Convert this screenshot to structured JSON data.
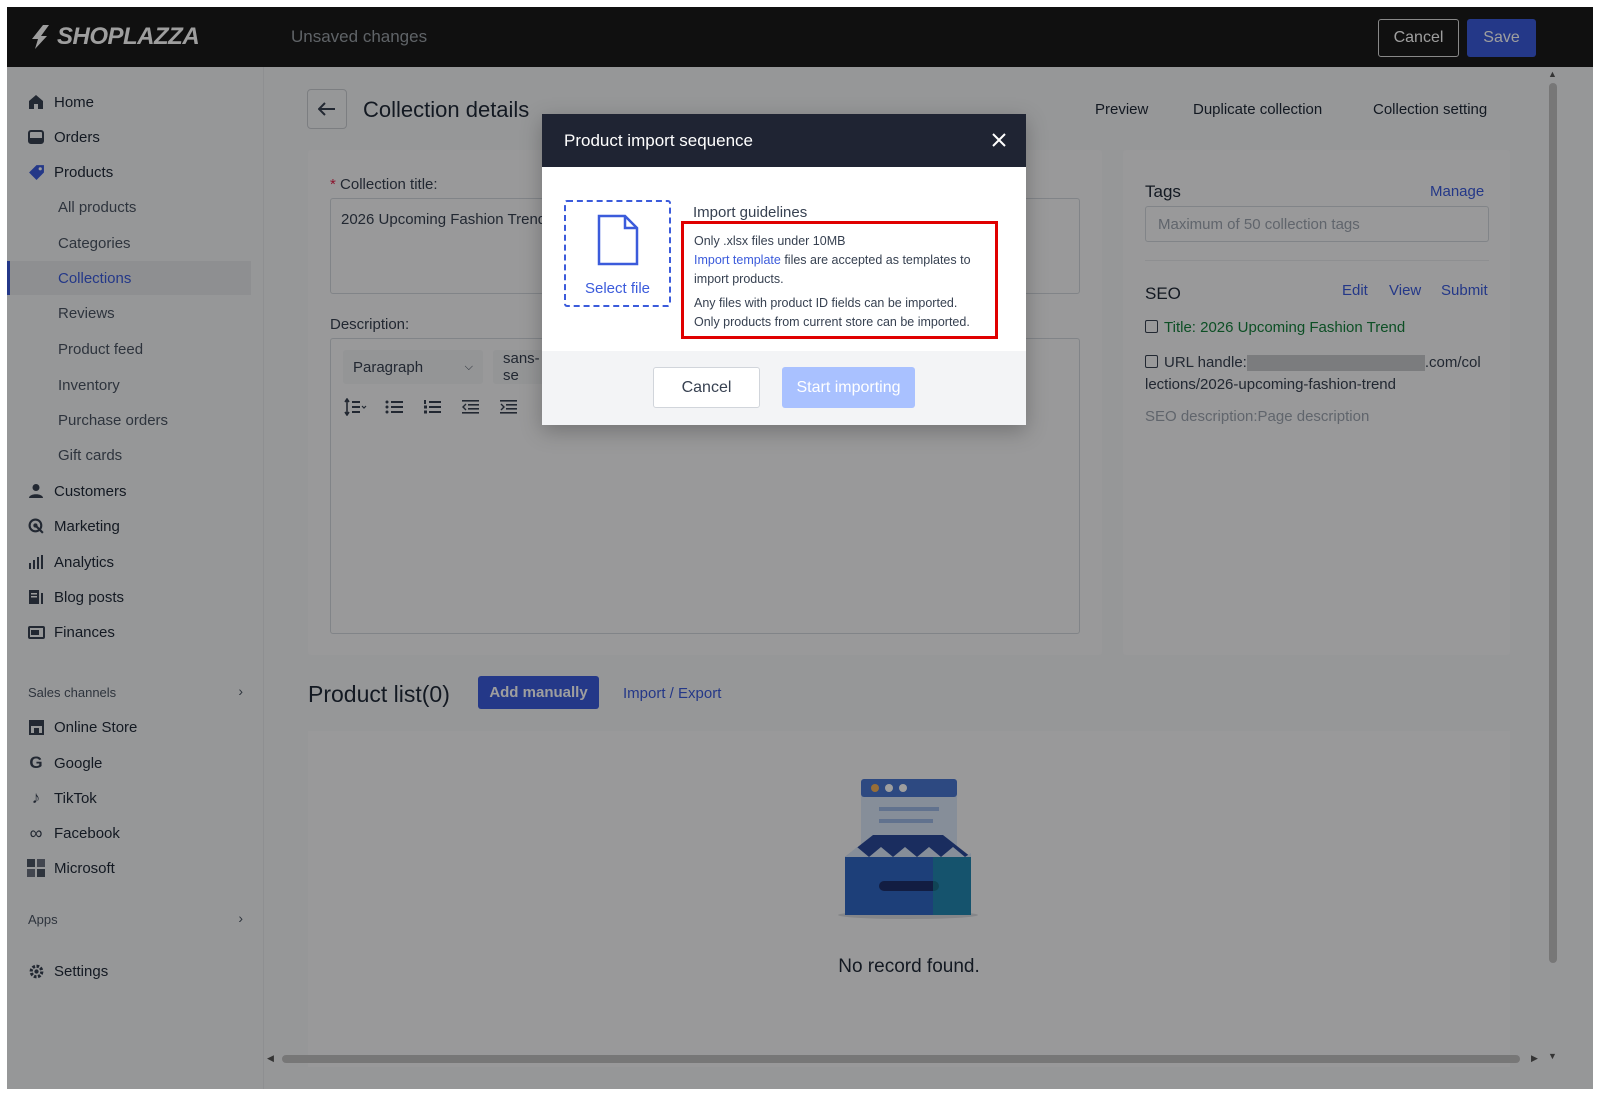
{
  "topbar": {
    "logo_text": "SHOPLAZZA",
    "status_text": "Unsaved changes",
    "cancel_label": "Cancel",
    "save_label": "Save"
  },
  "sidebar": {
    "items": [
      {
        "label": "Home",
        "icon": "home-icon"
      },
      {
        "label": "Orders",
        "icon": "orders-icon"
      },
      {
        "label": "Products",
        "icon": "tag-icon"
      }
    ],
    "product_subitems": [
      {
        "label": "All products"
      },
      {
        "label": "Categories"
      },
      {
        "label": "Collections",
        "active": true
      },
      {
        "label": "Reviews"
      },
      {
        "label": "Product feed"
      },
      {
        "label": "Inventory"
      },
      {
        "label": "Purchase orders"
      },
      {
        "label": "Gift cards"
      }
    ],
    "items_lower": [
      {
        "label": "Customers",
        "icon": "person-icon"
      },
      {
        "label": "Marketing",
        "icon": "marketing-icon"
      },
      {
        "label": "Analytics",
        "icon": "analytics-icon"
      },
      {
        "label": "Blog posts",
        "icon": "blog-icon"
      },
      {
        "label": "Finances",
        "icon": "finances-icon"
      }
    ],
    "sales_channels_label": "Sales channels",
    "channels": [
      {
        "label": "Online Store",
        "icon": "store-icon"
      },
      {
        "label": "Google",
        "icon": "google-icon"
      },
      {
        "label": "TikTok",
        "icon": "tiktok-icon"
      },
      {
        "label": "Facebook",
        "icon": "meta-icon"
      },
      {
        "label": "Microsoft",
        "icon": "microsoft-icon"
      }
    ],
    "apps_label": "Apps",
    "settings_label": "Settings"
  },
  "main": {
    "page_title": "Collection details",
    "links": {
      "preview": "Preview",
      "duplicate": "Duplicate collection",
      "setting": "Collection setting"
    },
    "collection_title_label": "Collection title:",
    "collection_title_value": "2026 Upcoming Fashion Trend",
    "description_label": "Description:",
    "editor_paragraph": "Paragraph",
    "editor_font": "sans-se",
    "tags_label": "Tags",
    "tags_manage": "Manage",
    "tags_placeholder": "Maximum of 50 collection tags",
    "seo_label": "SEO",
    "seo_edit": "Edit",
    "seo_view": "View",
    "seo_submit": "Submit",
    "seo_title": "Title: 2026 Upcoming Fashion Trend",
    "seo_url_prefix": "URL handle:",
    "seo_url_suffix": ".com/col",
    "seo_url_line2": "lections/2026-upcoming-fashion-trend",
    "seo_description": "SEO description:Page description",
    "product_list_title": "Product list(0)",
    "add_manually": "Add manually",
    "import_export": "Import / Export",
    "no_record": "No record found."
  },
  "modal": {
    "title": "Product import sequence",
    "select_file": "Select file",
    "guidelines_title": "Import guidelines",
    "line1": "Only .xlsx files under 10MB",
    "template_link": "Import template",
    "line2_rest": " files are accepted as templates to import products.",
    "line3": "Any files with product ID fields can be imported.",
    "line4": "Only products from current store can be imported.",
    "cancel_label": "Cancel",
    "start_label": "Start importing"
  },
  "colors": {
    "accent": "#3b5bdb",
    "highlight_border": "#e00000",
    "header_bg": "#1a1a1a"
  }
}
